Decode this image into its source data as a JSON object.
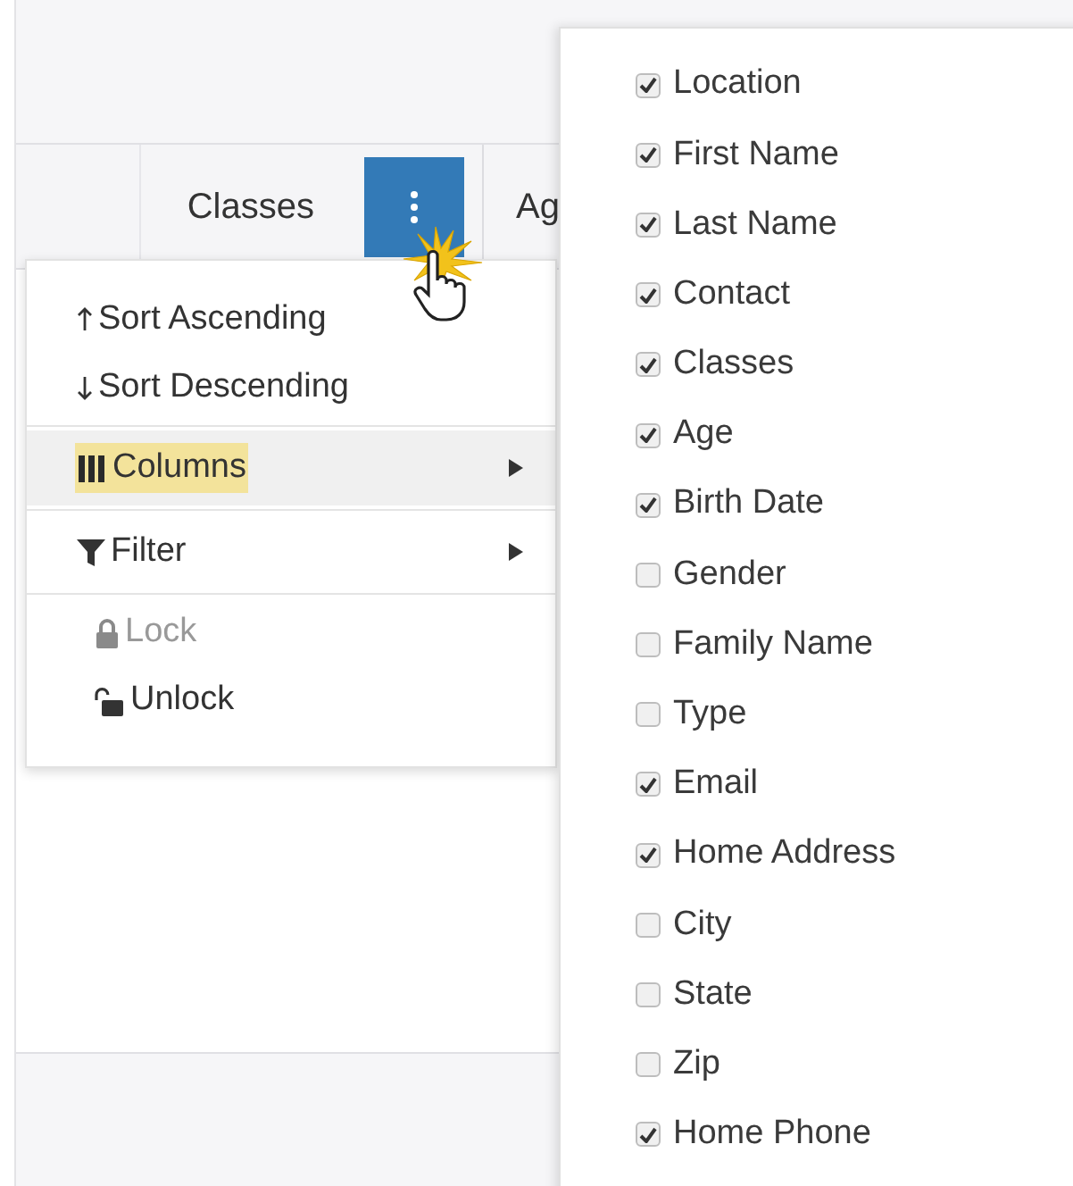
{
  "header": {
    "columns": [
      {
        "label": "Classes"
      },
      {
        "label": "Ag"
      }
    ],
    "menu_button": {
      "pressed": true
    }
  },
  "column_menu": {
    "items": [
      {
        "kind": "sort-asc",
        "label": "Sort Ascending",
        "disabled": false,
        "highlighted": false
      },
      {
        "kind": "sort-desc",
        "label": "Sort Descending",
        "disabled": false,
        "highlighted": false
      },
      {
        "kind": "columns",
        "label": "Columns",
        "disabled": false,
        "highlighted": true
      },
      {
        "kind": "filter",
        "label": "Filter",
        "disabled": false,
        "highlighted": false
      },
      {
        "kind": "lock",
        "label": "Lock",
        "disabled": true,
        "highlighted": false
      },
      {
        "kind": "unlock",
        "label": "Unlock",
        "disabled": false,
        "highlighted": false
      }
    ]
  },
  "columns_submenu": [
    {
      "label": "Location",
      "checked": true
    },
    {
      "label": "First Name",
      "checked": true
    },
    {
      "label": "Last Name",
      "checked": true
    },
    {
      "label": "Contact",
      "checked": true
    },
    {
      "label": "Classes",
      "checked": true
    },
    {
      "label": "Age",
      "checked": true
    },
    {
      "label": "Birth Date",
      "checked": true
    },
    {
      "label": "Gender",
      "checked": false
    },
    {
      "label": "Family Name",
      "checked": false
    },
    {
      "label": "Type",
      "checked": false
    },
    {
      "label": "Email",
      "checked": true
    },
    {
      "label": "Home Address",
      "checked": true
    },
    {
      "label": "City",
      "checked": false
    },
    {
      "label": "State",
      "checked": false
    },
    {
      "label": "Zip",
      "checked": false
    },
    {
      "label": "Home Phone",
      "checked": true
    }
  ]
}
